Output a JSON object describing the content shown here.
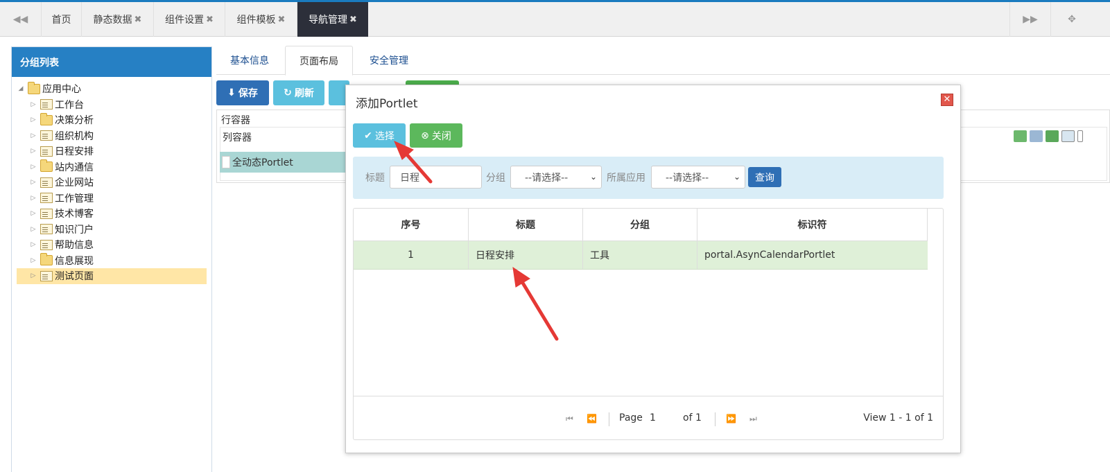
{
  "topbar": {
    "tabs": [
      {
        "label": "首页",
        "closable": false
      },
      {
        "label": "静态数据",
        "closable": true
      },
      {
        "label": "组件设置",
        "closable": true
      },
      {
        "label": "组件模板",
        "closable": true
      },
      {
        "label": "导航管理",
        "closable": true,
        "active": true
      }
    ],
    "close_glyph": "✖",
    "prev_icon": "⏪",
    "next_icon": "⏩",
    "fullscreen_icon": "⛶"
  },
  "sidebar": {
    "title": "分组列表",
    "root": "应用中心",
    "items": [
      {
        "label": "工作台",
        "type": "doc"
      },
      {
        "label": "决策分析",
        "type": "folder"
      },
      {
        "label": "组织机构",
        "type": "doc"
      },
      {
        "label": "日程安排",
        "type": "doc"
      },
      {
        "label": "站内通信",
        "type": "folder"
      },
      {
        "label": "企业网站",
        "type": "doc"
      },
      {
        "label": "工作管理",
        "type": "doc"
      },
      {
        "label": "技术博客",
        "type": "doc"
      },
      {
        "label": "知识门户",
        "type": "doc"
      },
      {
        "label": "帮助信息",
        "type": "doc"
      },
      {
        "label": "信息展现",
        "type": "folder"
      },
      {
        "label": "测试页面",
        "type": "doc",
        "selected": true
      }
    ]
  },
  "content": {
    "tabs": [
      "基本信息",
      "页面布局",
      "安全管理"
    ],
    "active_tab": "页面布局",
    "toolbar": {
      "save": "保存",
      "refresh": "刷新"
    },
    "layout": {
      "row_container": "行容器",
      "col_container": "列容器",
      "portlet": "全动态Portlet"
    }
  },
  "modal": {
    "title": "添加Portlet",
    "select_btn": "选择",
    "close_btn": "关闭",
    "filter": {
      "title_label": "标题",
      "title_value": "日程",
      "group_label": "分组",
      "group_value": "--请选择--",
      "app_label": "所属应用",
      "app_value": "--请选择--",
      "query_btn": "查询"
    },
    "grid": {
      "headers": [
        "序号",
        "标题",
        "分组",
        "标识符"
      ],
      "rows": [
        {
          "index": "1",
          "title": "日程安排",
          "group": "工具",
          "id": "portal.AsynCalendarPortlet"
        }
      ]
    },
    "pager": {
      "page_label": "Page",
      "page_value": "1",
      "of_label": "of 1",
      "view": "View 1 - 1 of 1"
    }
  },
  "colors": {
    "accent": "#1a7bbf",
    "panel_header": "#2680c4",
    "active_tab": "#2c2f3a",
    "selected_row": "#dff0d8",
    "arrow": "#e53935"
  }
}
